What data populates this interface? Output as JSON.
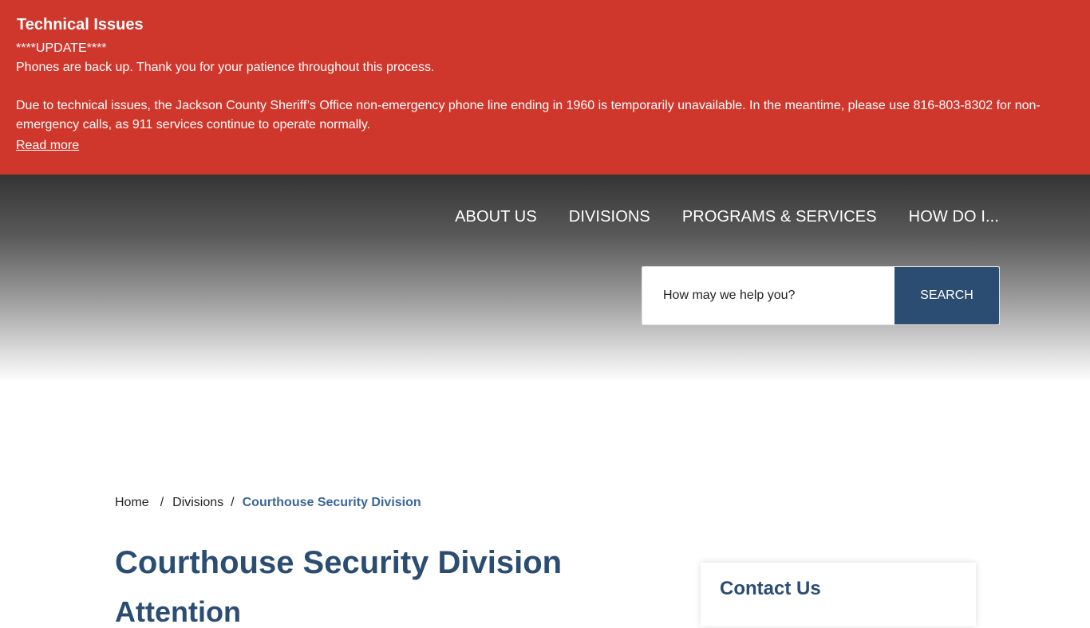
{
  "alert": {
    "title": "Technical Issues",
    "update": "****UPDATE****",
    "phones_back": "Phones are back up. Thank you for your patience throughout this process.",
    "detail_1": "Due to technical issues, the Jackson County Sheriff’s Office non-emergency phone line ending in 1960 is temporarily unavailable. In the meantime, please use 816-803-8302 for non-",
    "detail_2": "emergency calls, as 911 services continue to operate normally.",
    "read_more": "Read more",
    "background_color": "#cf372c"
  },
  "nav": {
    "items": [
      {
        "label": "ABOUT US"
      },
      {
        "label": "DIVISIONS"
      },
      {
        "label": "PROGRAMS & SERVICES"
      },
      {
        "label": "HOW DO I..."
      }
    ]
  },
  "search": {
    "placeholder": "How may we help you?",
    "button_label": "SEARCH",
    "button_color": "#2c4d72"
  },
  "breadcrumb": {
    "home": "Home",
    "sep1": "/",
    "divisions": "Divisions",
    "sep2": "/",
    "current": "Courthouse Security Division"
  },
  "main": {
    "title": "Courthouse Security Division",
    "subheading": "Attention"
  },
  "sidebar": {
    "contact_title": "Contact Us"
  },
  "colors": {
    "brand": "#2c4d72",
    "breadcrumb_active": "#3b6699"
  }
}
